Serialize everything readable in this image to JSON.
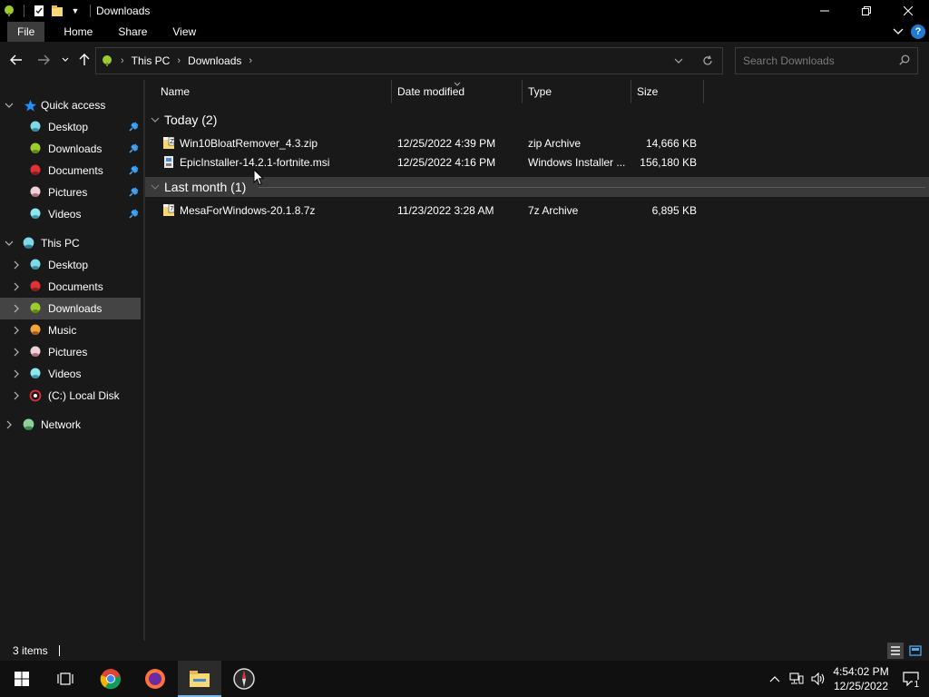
{
  "window": {
    "title": "Downloads",
    "controls": [
      "minimize",
      "restore",
      "close"
    ]
  },
  "ribbon": {
    "tabs": [
      {
        "label": "File"
      },
      {
        "label": "Home"
      },
      {
        "label": "Share"
      },
      {
        "label": "View"
      }
    ],
    "help_label": "?"
  },
  "address": {
    "breadcrumbs": [
      "This PC",
      "Downloads"
    ],
    "search_placeholder": "Search Downloads"
  },
  "sidebar": {
    "quick_access": {
      "label": "Quick access",
      "items": [
        {
          "label": "Desktop",
          "icon": "desktop-icon",
          "pinned": true
        },
        {
          "label": "Downloads",
          "icon": "downloads-icon",
          "pinned": true
        },
        {
          "label": "Documents",
          "icon": "documents-icon",
          "pinned": true
        },
        {
          "label": "Pictures",
          "icon": "pictures-icon",
          "pinned": true
        },
        {
          "label": "Videos",
          "icon": "videos-icon",
          "pinned": true
        }
      ]
    },
    "this_pc": {
      "label": "This PC",
      "items": [
        {
          "label": "Desktop",
          "icon": "desktop-icon"
        },
        {
          "label": "Documents",
          "icon": "documents-icon"
        },
        {
          "label": "Downloads",
          "icon": "downloads-icon",
          "selected": true
        },
        {
          "label": "Music",
          "icon": "music-icon"
        },
        {
          "label": "Pictures",
          "icon": "pictures-icon"
        },
        {
          "label": "Videos",
          "icon": "videos-icon"
        },
        {
          "label": "(C:) Local Disk",
          "icon": "local-disk-icon"
        }
      ]
    },
    "network": {
      "label": "Network"
    }
  },
  "columns": [
    "Name",
    "Date modified",
    "Type",
    "Size"
  ],
  "groups": [
    {
      "label": "Today (2)",
      "files": [
        {
          "name": "Win10BloatRemover_4.3.zip",
          "date": "12/25/2022 4:39 PM",
          "type": "zip Archive",
          "size": "14,666 KB",
          "icon": "zip-file-icon"
        },
        {
          "name": "EpicInstaller-14.2.1-fortnite.msi",
          "date": "12/25/2022 4:16 PM",
          "type": "Windows Installer ...",
          "size": "156,180 KB",
          "icon": "msi-file-icon"
        }
      ]
    },
    {
      "label": "Last month (1)",
      "files": [
        {
          "name": "MesaForWindows-20.1.8.7z",
          "date": "11/23/2022 3:28 AM",
          "type": "7z Archive",
          "size": "6,895 KB",
          "icon": "7z-file-icon"
        }
      ]
    }
  ],
  "status": {
    "item_count": "3 items"
  },
  "taskbar": {
    "apps": [
      "start-icon",
      "task-view-icon",
      "chrome-icon",
      "firefox-icon",
      "file-explorer-icon",
      "compass-app-icon"
    ],
    "clock_time": "4:54:02 PM",
    "clock_date": "12/25/2022",
    "notification_count": "1"
  },
  "colors": {
    "background": "#191919",
    "titlebar": "#000000",
    "selected": "#444444",
    "accent": "#76b9ed",
    "folder_yellow": "#f8d775"
  }
}
